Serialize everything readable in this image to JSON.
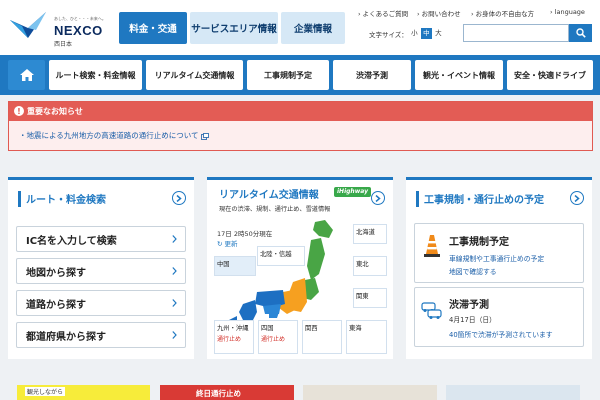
{
  "header": {
    "logo_tagline": "あした、ひと・・・未来へ。",
    "logo_name": "NEXCO",
    "logo_sub": "西日本",
    "main_tabs": [
      {
        "label": "料金・交通",
        "active": true
      },
      {
        "label": "サービスエリア情報",
        "active": false
      },
      {
        "label": "企業情報",
        "active": false
      }
    ],
    "util_links": {
      "faq": "よくあるご質問",
      "contact": "お問い合わせ",
      "accessibility": "お身体の不自由な方",
      "language": "language"
    },
    "font_size": {
      "label": "文字サイズ：",
      "small": "小",
      "medium": "中",
      "large": "大",
      "selected": "中"
    },
    "search": {
      "value": "",
      "placeholder": ""
    }
  },
  "nav": {
    "items": [
      "ルート検索・料金情報",
      "リアルタイム交通情報",
      "工事規制予定",
      "渋滞予測",
      "観光・イベント情報",
      "安全・快適ドライブ"
    ]
  },
  "notice": {
    "title": "重要なお知らせ",
    "link": "・地震による九州地方の高速道路の通行止めについて"
  },
  "route_card": {
    "title": "ルート・料金検索",
    "buttons": [
      "IC名を入力して検索",
      "地図から探す",
      "道路から探す",
      "都道府県から探す"
    ]
  },
  "traffic_card": {
    "title": "リアルタイム交通情報",
    "badge": "iHighway",
    "subtitle": "現在の渋滞、規制、通行止め、雪道情報",
    "time": "17日 2時50分現在",
    "update": "更新",
    "regions": {
      "chugoku": "中国",
      "hokuriku": "北陸・信越",
      "hokkaido": "北海道",
      "tohoku": "東北",
      "kanto": "関東",
      "kyushu": "九州・沖縄",
      "shikoku": "四国",
      "kansai": "関西",
      "tokai": "東海",
      "kyushu_status": "通行止め",
      "shikoku_status": "通行止め"
    }
  },
  "works_card": {
    "title": "工事規制・通行止めの予定",
    "items": [
      {
        "title": "工事規制予定",
        "line1": "車線規制や工事通行止めの予定",
        "line2": "地図で確認する"
      },
      {
        "title": "渋滞予測",
        "line1": "4月17日（日）",
        "line2": "40箇所で渋滞が予測されています"
      }
    ]
  },
  "bottom": {
    "banner_text": "観光しながら",
    "closure_banner": "終日通行止め"
  },
  "colors": {
    "primary": "#1f78c1",
    "notice_red": "#e35c55",
    "page_bg": "#eef1f4"
  }
}
